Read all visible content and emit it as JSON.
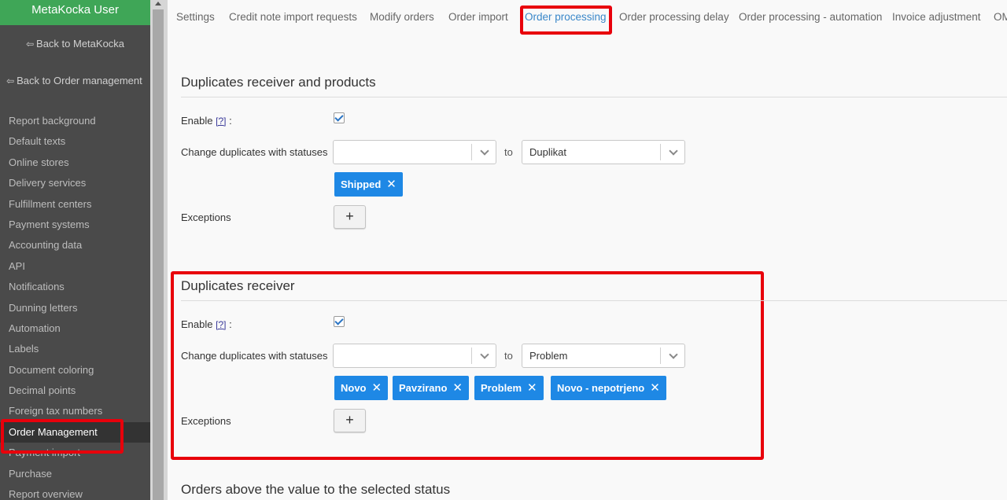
{
  "sidebar": {
    "title": "MetaKocka User",
    "back_metakocka": "Back to MetaKocka",
    "back_order_management": "Back to Order management",
    "items": [
      {
        "label": "Report background"
      },
      {
        "label": "Default texts"
      },
      {
        "label": "Online stores"
      },
      {
        "label": "Delivery services"
      },
      {
        "label": "Fulfillment centers"
      },
      {
        "label": "Payment systems"
      },
      {
        "label": "Accounting data"
      },
      {
        "label": "API"
      },
      {
        "label": "Notifications"
      },
      {
        "label": "Dunning letters"
      },
      {
        "label": "Automation"
      },
      {
        "label": "Labels"
      },
      {
        "label": "Document coloring"
      },
      {
        "label": "Decimal points"
      },
      {
        "label": "Foreign tax numbers"
      },
      {
        "label": "Order Management"
      },
      {
        "label": "Payment import"
      },
      {
        "label": "Purchase"
      },
      {
        "label": "Report overview"
      }
    ],
    "active_item": "Order Management"
  },
  "tabs": [
    {
      "label": "Settings"
    },
    {
      "label": "Credit note import requests"
    },
    {
      "label": "Modify orders"
    },
    {
      "label": "Order import"
    },
    {
      "label": "Order processing"
    },
    {
      "label": "Order processing delay"
    },
    {
      "label": "Order processing - automation"
    },
    {
      "label": "Invoice adjustment"
    },
    {
      "label": "OM"
    }
  ],
  "active_tab": "Order processing",
  "section1": {
    "title": "Duplicates receiver and products",
    "enable_label": "Enable",
    "help": "[?]",
    "colon": ":",
    "enabled": true,
    "change_label": "Change duplicates with statuses",
    "from_value": "",
    "to_label": "to",
    "to_value": "Duplikat",
    "tags": [
      "Shipped"
    ],
    "exceptions_label": "Exceptions",
    "add_symbol": "+"
  },
  "section2": {
    "title": "Duplicates receiver",
    "enable_label": "Enable",
    "help": "[?]",
    "colon": ":",
    "enabled": true,
    "change_label": "Change duplicates with statuses",
    "from_value": "",
    "to_label": "to",
    "to_value": "Problem",
    "tags": [
      "Novo",
      "Pavzirano",
      "Problem",
      "Novo - nepotrjeno"
    ],
    "exceptions_label": "Exceptions",
    "add_symbol": "+"
  },
  "section3": {
    "title": "Orders above the value to the selected status"
  },
  "icons": {
    "back": "sign-out-icon",
    "remove": "close-icon",
    "dropdown": "chevron-down-icon",
    "check": "checkmark-icon"
  },
  "colors": {
    "sidebar_header": "#3fa657",
    "sidebar_bg": "#4a4a4a",
    "accent_tab": "#3a87c9",
    "tag": "#1e88e5",
    "highlight": "#e8000b"
  }
}
